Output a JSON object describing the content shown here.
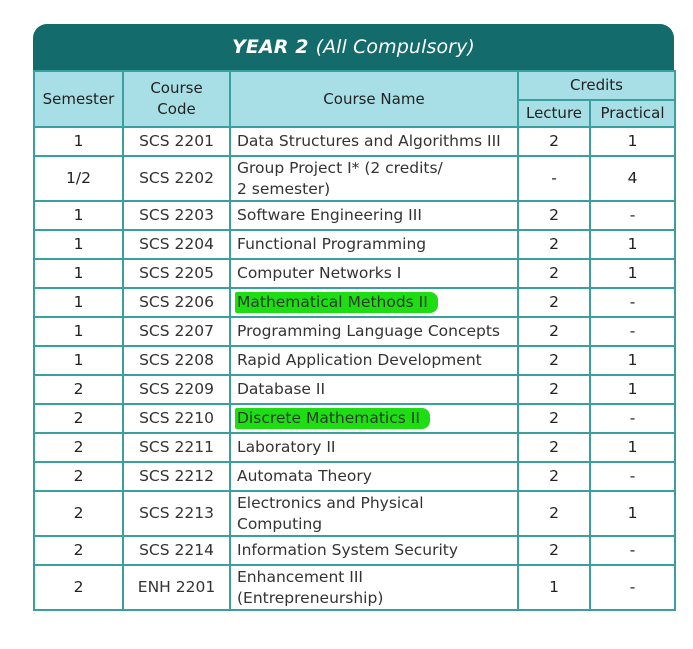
{
  "banner": {
    "title_bold": "YEAR 2",
    "title_rest": "(All Compulsory)"
  },
  "header": {
    "semester": "Semester",
    "course_code": "Course Code",
    "course_name": "Course Name",
    "credits": "Credits",
    "lecture": "Lecture",
    "practical": "Practical"
  },
  "rows": [
    {
      "semester": "1",
      "code": "SCS 2201",
      "name": "Data Structures and Algorithms III",
      "lecture": "2",
      "practical": "1"
    },
    {
      "semester": "1/2",
      "code": "SCS 2202",
      "name": "Group Project I* (2 credits/\n2 semester)",
      "lecture": "-",
      "practical": "4"
    },
    {
      "semester": "1",
      "code": "SCS 2203",
      "name": "Software Engineering III",
      "lecture": "2",
      "practical": "-"
    },
    {
      "semester": "1",
      "code": "SCS 2204",
      "name": "Functional Programming",
      "lecture": "2",
      "practical": "1"
    },
    {
      "semester": "1",
      "code": "SCS 2205",
      "name": "Computer Networks I",
      "lecture": "2",
      "practical": "1"
    },
    {
      "semester": "1",
      "code": "SCS 2206",
      "name": "Mathematical Methods II",
      "lecture": "2",
      "practical": "-"
    },
    {
      "semester": "1",
      "code": "SCS 2207",
      "name": "Programming Language Concepts",
      "lecture": "2",
      "practical": "-"
    },
    {
      "semester": "1",
      "code": "SCS 2208",
      "name": "Rapid Application Development",
      "lecture": "2",
      "practical": "1"
    },
    {
      "semester": "2",
      "code": "SCS 2209",
      "name": "Database II",
      "lecture": "2",
      "practical": "1"
    },
    {
      "semester": "2",
      "code": "SCS 2210",
      "name": "Discrete Mathematics II",
      "lecture": "2",
      "practical": "-"
    },
    {
      "semester": "2",
      "code": "SCS 2211",
      "name": "Laboratory II",
      "lecture": "2",
      "practical": "1"
    },
    {
      "semester": "2",
      "code": "SCS 2212",
      "name": "Automata Theory",
      "lecture": "2",
      "practical": "-"
    },
    {
      "semester": "2",
      "code": "SCS 2213",
      "name": "Electronics and Physical\nComputing",
      "lecture": "2",
      "practical": "1"
    },
    {
      "semester": "2",
      "code": "SCS 2214",
      "name": "Information System Security",
      "lecture": "2",
      "practical": "-"
    },
    {
      "semester": "2",
      "code": "ENH 2201",
      "name": "Enhancement III\n(Entrepreneurship)",
      "lecture": "1",
      "practical": "-"
    }
  ],
  "highlight_color": "#1edd12",
  "accent_color": "#146b6b",
  "header_bg_color": "#a8dfe6"
}
